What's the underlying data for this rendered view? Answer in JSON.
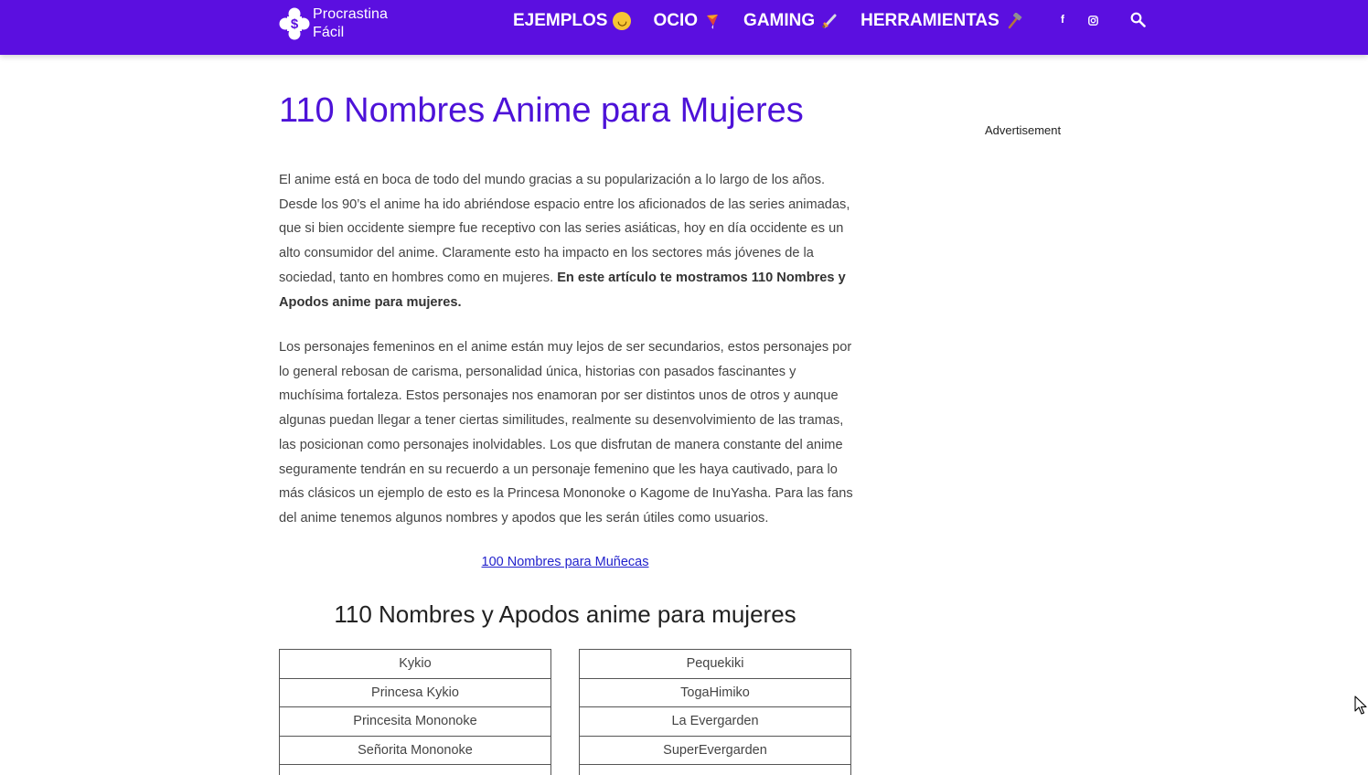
{
  "header": {
    "logo_line1": "Procrastina",
    "logo_line2": "Fácil",
    "nav": [
      {
        "label": "EJEMPLOS",
        "emoji": "😊"
      },
      {
        "label": "OCIO",
        "emoji": "🪁"
      },
      {
        "label": "GAMING",
        "emoji": "🗡"
      },
      {
        "label": "HERRAMIENTAS",
        "emoji": "🔨"
      }
    ],
    "social": {
      "facebook": "f"
    },
    "accent_color": "#5b0fe0"
  },
  "article": {
    "title": "110 Nombres Anime para Mujeres",
    "p1_text": "El anime está en boca de todo del mundo gracias a su popularización a lo largo de los años. Desde los 90’s el anime ha ido abriéndose espacio entre los aficionados de las series animadas, que si bien occidente siempre fue receptivo con las series asiáticas, hoy en día occidente es un alto consumidor del anime. Claramente esto ha impacto en los sectores más jóvenes de la sociedad, tanto en hombres como en mujeres. ",
    "p1_bold": "En este artículo te mostramos 110 Nombres y Apodos anime para mujeres.",
    "p2_text": "Los personajes femeninos en el anime están muy lejos de ser secundarios, estos personajes por lo general rebosan de carisma, personalidad única, historias con pasados fascinantes y muchísima fortaleza. Estos personajes nos enamoran por ser distintos unos de otros y aunque algunas puedan llegar a tener ciertas similitudes, realmente su desenvolvimiento de las tramas, las posicionan como personajes inolvidables. Los que disfrutan de manera constante del anime seguramente tendrán en su recuerdo a un personaje femenino que les haya cautivado, para lo más clásicos un ejemplo de esto es la Princesa Mononoke o Kagome de InuYasha. Para las fans del anime tenemos algunos nombres y apodos que les serán útiles como usuarios.",
    "related_link": "100 Nombres para Muñecas",
    "section_heading": "110 Nombres y Apodos anime para mujeres",
    "table_left": [
      "Kykio",
      "Princesa Kykio",
      "Princesita Mononoke",
      "Señorita Mononoke"
    ],
    "table_right": [
      "Pequekiki",
      "TogaHimiko",
      "La Evergarden",
      "SuperEvergarden"
    ]
  },
  "sidebar": {
    "ad_label": "Advertisement"
  }
}
